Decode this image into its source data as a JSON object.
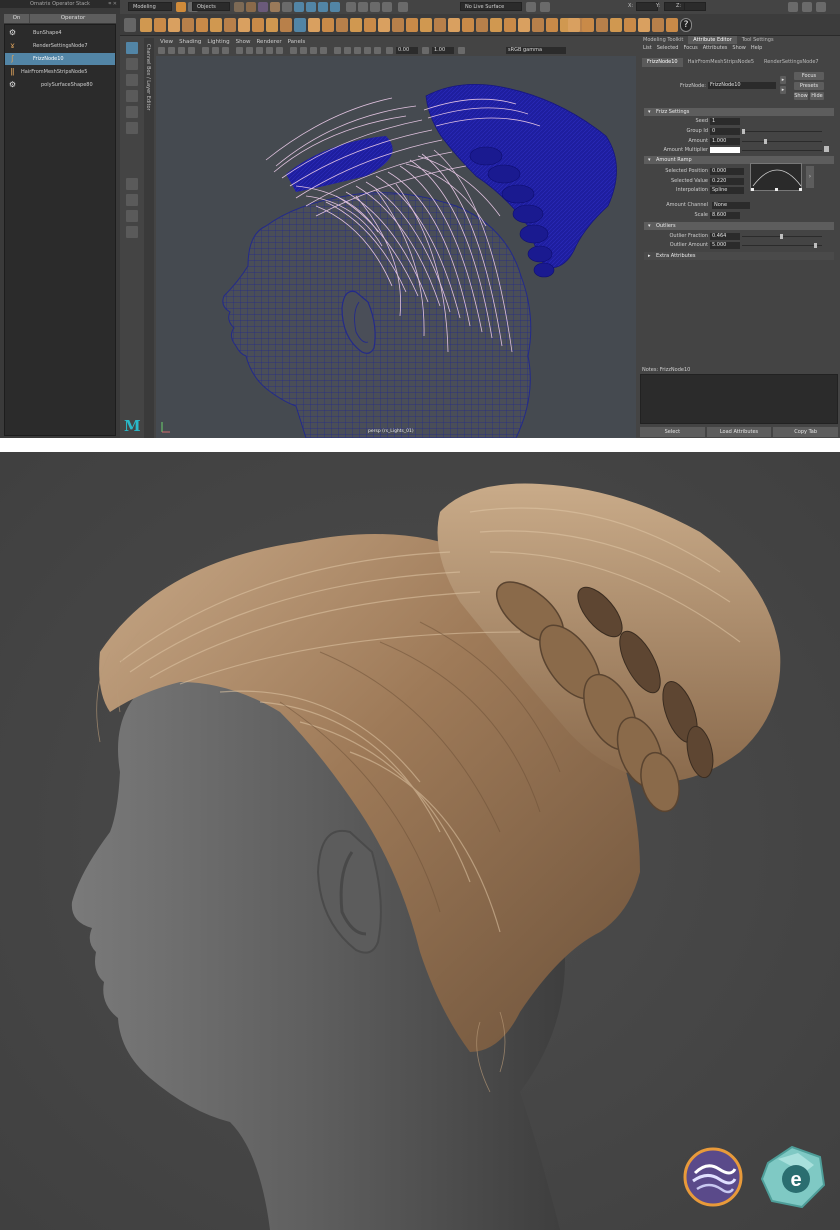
{
  "operator_panel": {
    "title": "Ornatrix Operator Stack",
    "col_on": "On",
    "col_operator": "Operator",
    "items": [
      {
        "label": "BunShape4"
      },
      {
        "label": "RenderSettingsNode7"
      },
      {
        "label": "FrizzNode10"
      },
      {
        "label": "HairFromMeshStripsNode5"
      },
      {
        "label": "polySurfaceShape80"
      }
    ]
  },
  "toolbar": {
    "workspace": "Modeling",
    "objects": "Objects",
    "live_surface": "No Live Surface",
    "x_label": "X:",
    "y_label": "Y:",
    "z_label": "Z:"
  },
  "viewport": {
    "menu": [
      "View",
      "Shading",
      "Lighting",
      "Show",
      "Renderer",
      "Panels"
    ],
    "field_a": "0.00",
    "field_b": "1.00",
    "color_space": "sRGB gamma",
    "camera_caption": "persp (rs_Lights_01)",
    "side_tab": "Channel Box / Layer Editor",
    "outliner_tab": "Outliner"
  },
  "attribute_editor": {
    "tabs": [
      "Modeling Toolkit",
      "Attribute Editor",
      "Tool Settings"
    ],
    "menu": [
      "List",
      "Selected",
      "Focus",
      "Attributes",
      "Show",
      "Help"
    ],
    "node_tabs": [
      "FrizzNode10",
      "HairFromMeshStripsNode5",
      "RenderSettingsNode7"
    ],
    "node_label": "FrizzNode:",
    "node_name": "FrizzNode10",
    "btn_focus": "Focus",
    "btn_presets": "Presets",
    "btn_show": "Show",
    "btn_hide": "Hide",
    "section_frizz": "Frizz Settings",
    "seed_label": "Seed",
    "seed_value": "1",
    "group_label": "Group Id",
    "group_value": "0",
    "amount_label": "Amount",
    "amount_value": "1.000",
    "amount_mult_label": "Amount Multiplier",
    "section_ramp": "Amount Ramp",
    "selpos_label": "Selected Position",
    "selpos_value": "0.000",
    "selval_label": "Selected Value",
    "selval_value": "0.220",
    "interp_label": "Interpolation",
    "interp_value": "Spline",
    "channel_label": "Amount Channel",
    "channel_value": "None",
    "scale_label": "Scale",
    "scale_value": "8.600",
    "section_outliers": "Outliers",
    "outlier_frac_label": "Outlier Fraction",
    "outlier_frac_value": "0.464",
    "outlier_amt_label": "Outlier Amount",
    "outlier_amt_value": "5.000",
    "section_extra": "Extra Attributes",
    "notes_label": "Notes:  FrizzNode10",
    "btn_select": "Select",
    "btn_load": "Load Attributes",
    "btn_copy": "Copy Tab"
  },
  "colors": {
    "selection": "#5285a6",
    "wireframe": "#1a1aa0",
    "guide_hair": "#e8c8e6"
  },
  "icons": [
    "maya-logo-icon",
    "ornatrix-logo-icon",
    "ephere-logo-icon"
  ]
}
